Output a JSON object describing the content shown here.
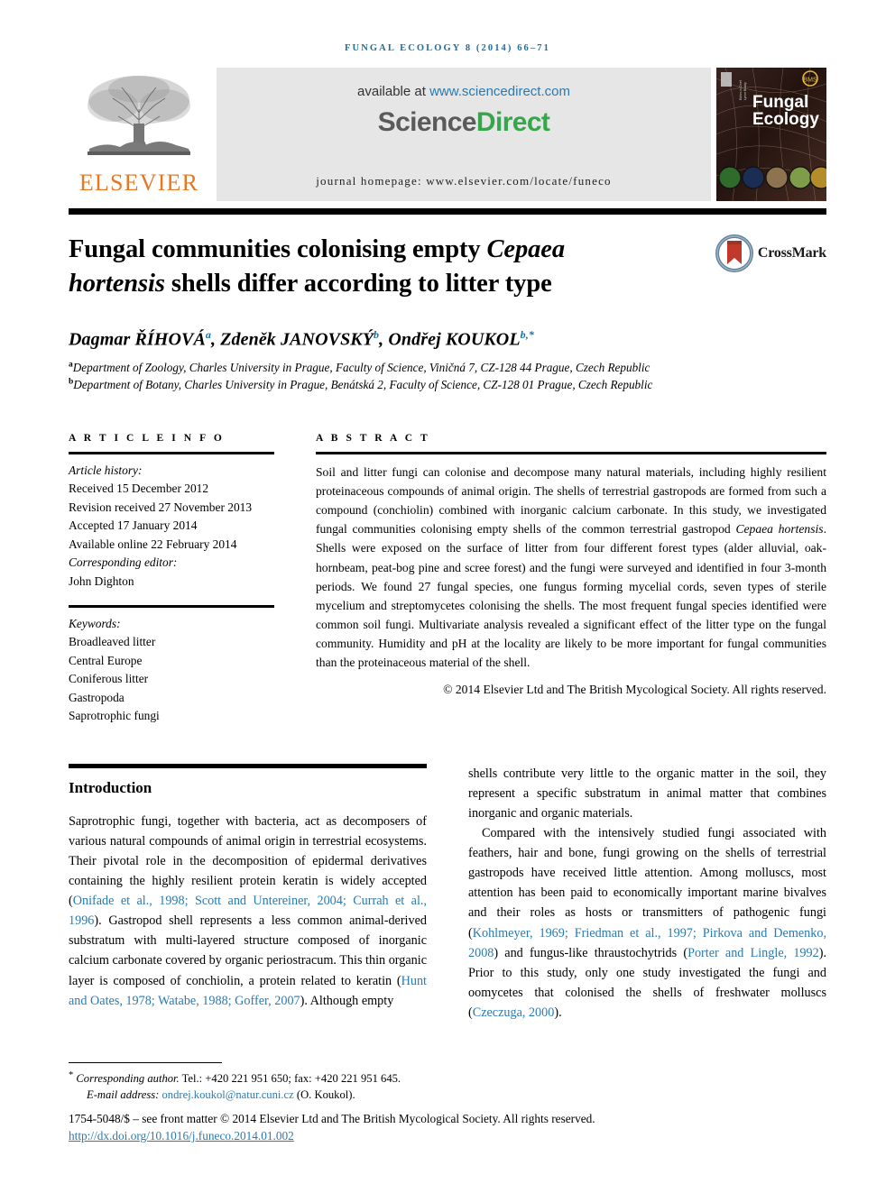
{
  "running_head": "FUNGAL ECOLOGY 8 (2014) 66–71",
  "masthead": {
    "publisher": "ELSEVIER",
    "available_at": "available at",
    "sciencedirect_url": "www.sciencedirect.com",
    "sciencedirect_logo_part1": "Science",
    "sciencedirect_logo_part2": "Direct",
    "journal_homepage": "journal homepage: www.elsevier.com/locate/funeco",
    "cover_title_line1": "Fungal",
    "cover_title_line2": "Ecology"
  },
  "title": {
    "line1_pre": "Fungal communities colonising empty ",
    "line1_italic": "Cepaea",
    "line2_italic": "hortensis",
    "line2_post": " shells differ according to litter type"
  },
  "crossmark": {
    "label": "CrossMark"
  },
  "authors": {
    "a1_name": "Dagmar ŘÍHOVÁ",
    "a1_sup": "a",
    "sep1": ", ",
    "a2_name": "Zdeněk JANOVSKÝ",
    "a2_sup": "b",
    "sep2": ", ",
    "a3_name": "Ondřej KOUKOL",
    "a3_sup": "b,*"
  },
  "affiliations": [
    {
      "marker": "a",
      "text": "Department of Zoology, Charles University in Prague, Faculty of Science, Viničná 7, CZ-128 44 Prague, Czech Republic"
    },
    {
      "marker": "b",
      "text": "Department of Botany, Charles University in Prague, Benátská 2, Faculty of Science, CZ-128 01 Prague, Czech Republic"
    }
  ],
  "article_info": {
    "heading": "A R T I C L E   I N F O",
    "history_label": "Article history:",
    "received": "Received 15 December 2012",
    "revision": "Revision received 27 November 2013",
    "accepted": "Accepted 17 January 2014",
    "available_online": "Available online 22 February 2014",
    "corresponding_editor_label": "Corresponding editor:",
    "corresponding_editor": "John Dighton",
    "keywords_label": "Keywords:",
    "keywords": [
      "Broadleaved litter",
      "Central Europe",
      "Coniferous litter",
      "Gastropoda",
      "Saprotrophic fungi"
    ]
  },
  "abstract": {
    "heading": "A B S T R A C T",
    "p1_part1": "Soil and litter fungi can colonise and decompose many natural materials, including highly resilient proteinaceous compounds of animal origin. The shells of terrestrial gastropods are formed from such a compound (conchiolin) combined with inorganic calcium carbonate. In this study, we investigated fungal communities colonising empty shells of the common terrestrial gastropod ",
    "p1_italic": "Cepaea hortensis",
    "p1_part2": ". Shells were exposed on the surface of litter from four different forest types (alder alluvial, oak-hornbeam, peat-bog pine and scree forest) and the fungi were surveyed and identified in four 3-month periods. We found 27 fungal species, one fungus forming mycelial cords, seven types of sterile mycelium and streptomycetes colonising the shells. The most frequent fungal species identified were common soil fungi. Multivariate analysis revealed a significant effect of the litter type on the fungal community. Humidity and pH at the locality are likely to be more important for fungal communities than the proteinaceous material of the shell.",
    "copyright": "© 2014 Elsevier Ltd and The British Mycological Society. All rights reserved."
  },
  "introduction": {
    "heading": "Introduction",
    "left_p1_a": "Saprotrophic fungi, together with bacteria, act as decomposers of various natural compounds of animal origin in terrestrial ecosystems. Their pivotal role in the decomposition of epidermal derivatives containing the highly resilient protein keratin is widely accepted (",
    "left_cite1": "Onifade et al., 1998; Scott and Untereiner, 2004; Currah et al., 1996",
    "left_p1_b": "). Gastropod shell represents a less common animal-derived substratum with multi-layered structure composed of inorganic calcium carbonate covered by organic periostracum. This thin organic layer is composed of conchiolin, a protein related to keratin (",
    "left_cite2": "Hunt and Oates, 1978; Watabe, 1988; Goffer, 2007",
    "left_p1_c": "). Although empty",
    "right_p1": "shells contribute very little to the organic matter in the soil, they represent a specific substratum in animal matter that combines inorganic and organic materials.",
    "right_p2_a": "Compared with the intensively studied fungi associated with feathers, hair and bone, fungi growing on the shells of terrestrial gastropods have received little attention. Among molluscs, most attention has been paid to economically important marine bivalves and their roles as hosts or transmitters of pathogenic fungi (",
    "right_cite1": "Kohlmeyer, 1969; Friedman et al., 1997; Pirkova and Demenko, 2008",
    "right_p2_b": ") and fungus-like thraustochytrids (",
    "right_cite2": "Porter and Lingle, 1992",
    "right_p2_c": "). Prior to this study, only one study investigated the fungi and oomycetes that colonised the shells of freshwater molluscs (",
    "right_cite3": "Czeczuga, 2000",
    "right_p2_d": ")."
  },
  "footnotes": {
    "corresponding_marker": "*",
    "corresponding_label": "Corresponding author.",
    "corresponding_contact": " Tel.: +420 221 951 650; fax: +420 221 951 645.",
    "email_label": "E-mail address: ",
    "email": "ondrej.koukol@natur.cuni.cz",
    "email_suffix": " (O. Koukol).",
    "frontmatter": "1754-5048/$ – see front matter © 2014 Elsevier Ltd and The British Mycological Society. All rights reserved.",
    "doi": "http://dx.doi.org/10.1016/j.funeco.2014.01.002"
  },
  "colors": {
    "link": "#2a7ab0",
    "running_head": "#1a6fa3",
    "elsevier_orange": "#E87722",
    "sciencedirect_green": "#36a64b"
  }
}
